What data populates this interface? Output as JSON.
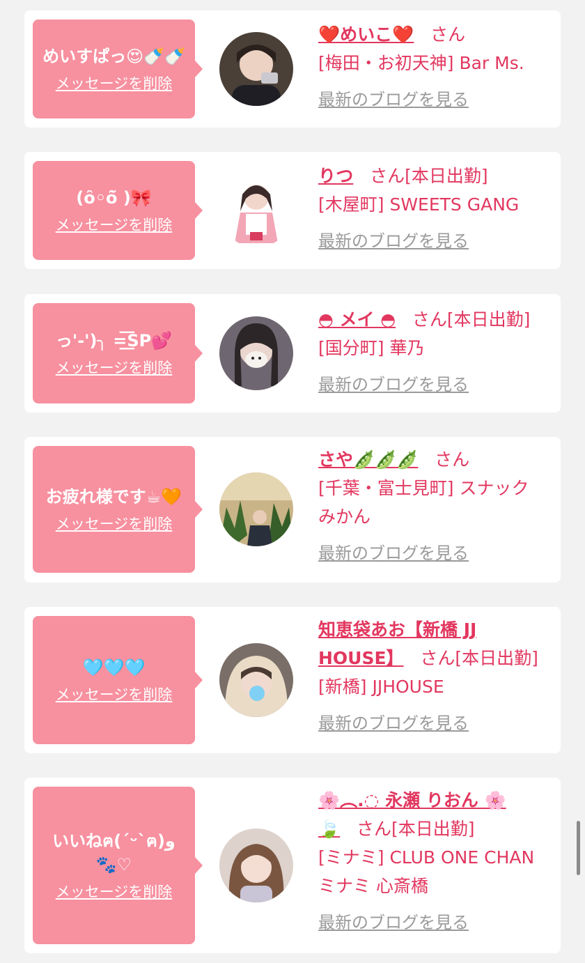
{
  "delete_label": "メッセージを削除",
  "blog_label": "最新のブログを見る",
  "items": [
    {
      "message": "めいすぱっ😍🍼🍼",
      "name": "❤️めいこ❤️",
      "suffix": "さん",
      "shop": "[梅田・お初天神] Bar Ms."
    },
    {
      "message": "(ȏ◦ȏ̆ )🎀",
      "name": "りつ",
      "suffix": "さん[本日出勤]",
      "shop": "[木屋町] SWEETS GANG"
    },
    {
      "message": "っ'-')╮ =͟͟͞͞SP💕",
      "name": "◓ メイ ◓",
      "suffix": "さん[本日出勤]",
      "shop": "[国分町] 華乃"
    },
    {
      "message": "お疲れ様です☕🧡",
      "name": "さや🫛🫛🫛",
      "suffix": "さん",
      "shop": "[千葉・富士見町] スナック みかん"
    },
    {
      "message": "🩵🩵🩵",
      "name": "知恵袋あお【新橋 JJ HOUSE】",
      "suffix": "さん[本日出勤]",
      "shop": "[新橋] JJHOUSE"
    },
    {
      "message": "いいねฅ(´ᵕ`ฅ)و 🐾♡",
      "name": "🌸︵.◌ 永瀬 りおん 🌸🍃",
      "suffix": "さん[本日出勤]",
      "shop": "[ミナミ] CLUB ONE CHAN ミナミ 心斎橋"
    }
  ]
}
